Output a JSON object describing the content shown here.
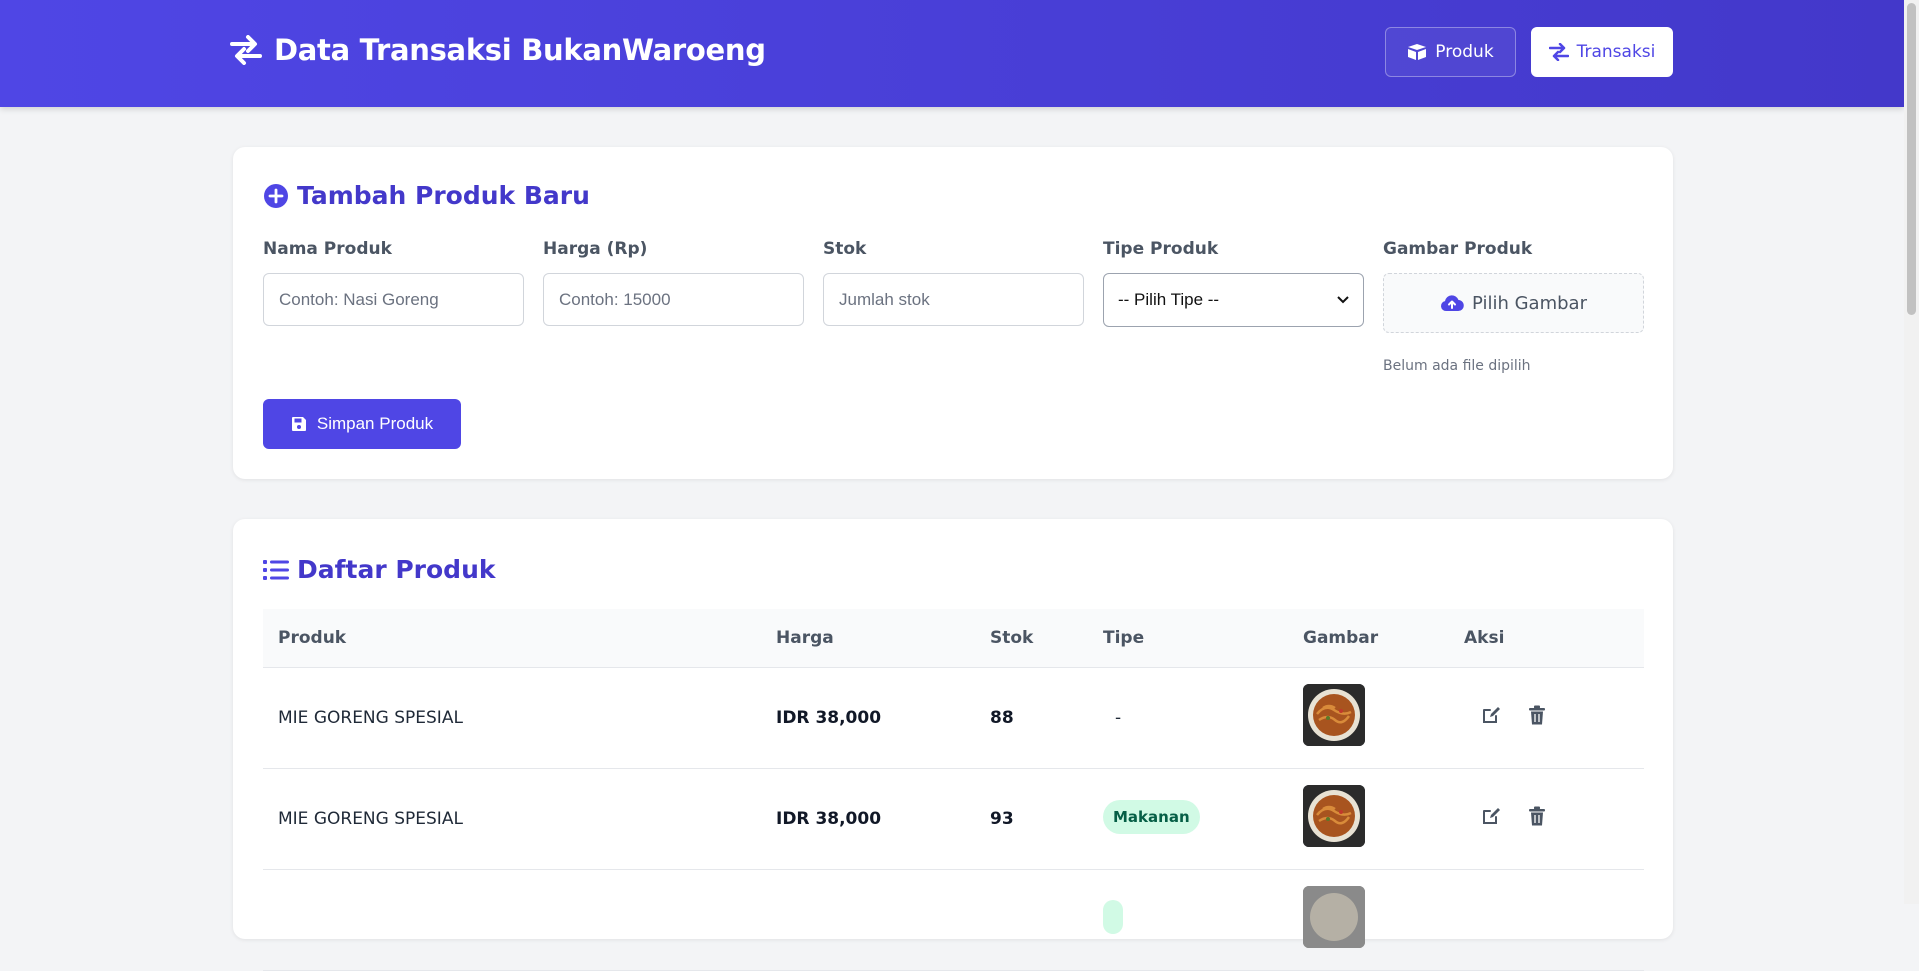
{
  "header": {
    "title": "Data Transaksi BukanWaroeng",
    "nav": {
      "produk_label": "Produk",
      "transaksi_label": "Transaksi"
    }
  },
  "form": {
    "title": "Tambah Produk Baru",
    "nama": {
      "label": "Nama Produk",
      "placeholder": "Contoh: Nasi Goreng"
    },
    "harga": {
      "label": "Harga (Rp)",
      "placeholder": "Contoh: 15000"
    },
    "stok": {
      "label": "Stok",
      "placeholder": "Jumlah stok"
    },
    "tipe": {
      "label": "Tipe Produk",
      "selected": "-- Pilih Tipe --"
    },
    "gambar": {
      "label": "Gambar Produk",
      "button": "Pilih Gambar",
      "hint": "Belum ada file dipilih"
    },
    "save_label": "Simpan Produk"
  },
  "list": {
    "title": "Daftar Produk",
    "columns": [
      "Produk",
      "Harga",
      "Stok",
      "Tipe",
      "Gambar",
      "Aksi"
    ],
    "rows": [
      {
        "produk": "MIE GORENG SPESIAL",
        "harga": "IDR 38,000",
        "stok": "88",
        "tipe": "-"
      },
      {
        "produk": "MIE GORENG SPESIAL",
        "harga": "IDR 38,000",
        "stok": "93",
        "tipe": "Makanan"
      }
    ]
  },
  "colors": {
    "primary": "#4f46e5",
    "badge_bg": "#d1fae5",
    "badge_text": "#065f46"
  }
}
